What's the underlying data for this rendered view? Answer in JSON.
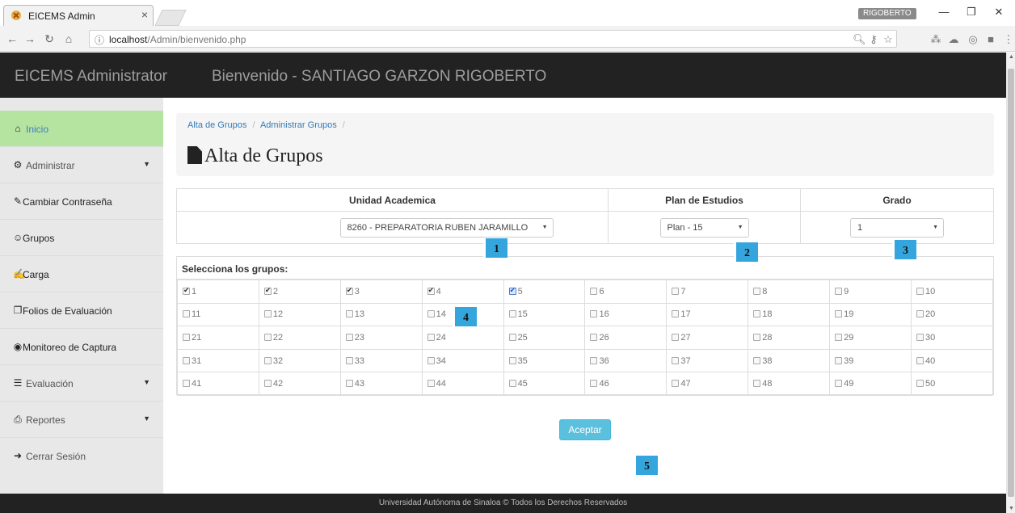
{
  "browser": {
    "tab_title": "EICEMS Admin",
    "tab_close": "×",
    "user_badge": "RIGOBERTO",
    "url_host": "localhost",
    "url_path": "/Admin/bienvenido.php"
  },
  "header": {
    "brand": "EICEMS Administrator",
    "welcome": "Bienvenido - SANTIAGO GARZON RIGOBERTO"
  },
  "sidebar": {
    "items": [
      {
        "label": "Inicio"
      },
      {
        "label": "Administrar"
      },
      {
        "label": "Cambiar Contraseña"
      },
      {
        "label": "Grupos"
      },
      {
        "label": "Carga"
      },
      {
        "label": "Folios de Evaluación"
      },
      {
        "label": "Monitoreo de Captura"
      },
      {
        "label": "Evaluación"
      },
      {
        "label": "Reportes"
      },
      {
        "label": "Cerrar Sesión"
      }
    ]
  },
  "breadcrumb": {
    "item1": "Alta de Grupos",
    "item2": "Administrar Grupos",
    "sep": "/"
  },
  "page_title": "Alta de Grupos",
  "selectors": {
    "unidad_header": "Unidad Academica",
    "plan_header": "Plan de Estudios",
    "grado_header": "Grado",
    "unidad_value": "8260 - PREPARATORIA RUBEN JARAMILLO",
    "plan_value": "Plan - 15",
    "grado_value": "1"
  },
  "groups": {
    "header": "Selecciona los grupos:",
    "checked": [
      "1",
      "2",
      "3",
      "4",
      "5"
    ],
    "focused": "5",
    "rows": [
      [
        "1",
        "2",
        "3",
        "4",
        "5",
        "6",
        "7",
        "8",
        "9",
        "10"
      ],
      [
        "11",
        "12",
        "13",
        "14",
        "15",
        "16",
        "17",
        "18",
        "19",
        "20"
      ],
      [
        "21",
        "22",
        "23",
        "24",
        "25",
        "26",
        "27",
        "28",
        "29",
        "30"
      ],
      [
        "31",
        "32",
        "33",
        "34",
        "35",
        "36",
        "37",
        "38",
        "39",
        "40"
      ],
      [
        "41",
        "42",
        "43",
        "44",
        "45",
        "46",
        "47",
        "48",
        "49",
        "50"
      ]
    ]
  },
  "accept_button": "Aceptar",
  "markers": {
    "m1": "1",
    "m2": "2",
    "m3": "3",
    "m4": "4",
    "m5": "5"
  },
  "footer": "Universidad Autónoma de Sinaloa © Todos los Derechos Reservados",
  "colors": {
    "header_bg": "#222222",
    "sidebar_bg": "#e8e8e8",
    "active_item": "#b5e3a0",
    "button": "#5bc0de",
    "marker": "#35a6dd",
    "link": "#337ab7"
  }
}
